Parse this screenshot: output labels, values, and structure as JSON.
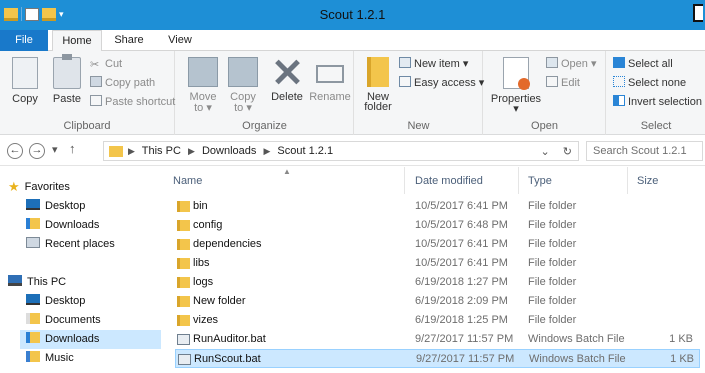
{
  "window": {
    "title": "Scout 1.2.1"
  },
  "tabs": [
    "File",
    "Home",
    "Share",
    "View"
  ],
  "ribbon": {
    "clipboard": {
      "label": "Clipboard",
      "copy": "Copy",
      "paste": "Paste",
      "cut": "Cut",
      "copy_path": "Copy path",
      "paste_shortcut": "Paste shortcut"
    },
    "organize": {
      "label": "Organize",
      "move_to": "Move",
      "move_to_sub": "to ▾",
      "copy_to": "Copy",
      "copy_to_sub": "to ▾",
      "delete": "Delete",
      "rename": "Rename"
    },
    "new": {
      "label": "New",
      "new_folder": "New",
      "new_folder_sub": "folder",
      "new_item": "New item ▾",
      "easy_access": "Easy access ▾"
    },
    "open": {
      "label": "Open",
      "properties": "Properties",
      "properties_sub": "▾",
      "open": "Open ▾",
      "edit": "Edit"
    },
    "select": {
      "label": "Select",
      "select_all": "Select all",
      "select_none": "Select none",
      "invert": "Invert selection"
    }
  },
  "address": {
    "crumbs": [
      "This PC",
      "Downloads",
      "Scout 1.2.1"
    ],
    "dropdown": "⌄",
    "refresh": "↻",
    "search_placeholder": "Search Scout 1.2.1"
  },
  "nav": {
    "favorites": "Favorites",
    "fav_items": [
      "Desktop",
      "Downloads",
      "Recent places"
    ],
    "this_pc": "This PC",
    "pc_items": [
      "Desktop",
      "Documents",
      "Downloads",
      "Music"
    ]
  },
  "columns": {
    "name": "Name",
    "date": "Date modified",
    "type": "Type",
    "size": "Size"
  },
  "files": [
    {
      "name": "bin",
      "date": "10/5/2017 6:41 PM",
      "type": "File folder",
      "size": ""
    },
    {
      "name": "config",
      "date": "10/5/2017 6:48 PM",
      "type": "File folder",
      "size": ""
    },
    {
      "name": "dependencies",
      "date": "10/5/2017 6:41 PM",
      "type": "File folder",
      "size": ""
    },
    {
      "name": "libs",
      "date": "10/5/2017 6:41 PM",
      "type": "File folder",
      "size": ""
    },
    {
      "name": "logs",
      "date": "6/19/2018 1:27 PM",
      "type": "File folder",
      "size": ""
    },
    {
      "name": "New folder",
      "date": "6/19/2018 2:09 PM",
      "type": "File folder",
      "size": ""
    },
    {
      "name": "vizes",
      "date": "6/19/2018 1:25 PM",
      "type": "File folder",
      "size": ""
    },
    {
      "name": "RunAuditor.bat",
      "date": "9/27/2017 11:57 PM",
      "type": "Windows Batch File",
      "size": "1 KB"
    },
    {
      "name": "RunScout.bat",
      "date": "9/27/2017 11:57 PM",
      "type": "Windows Batch File",
      "size": "1 KB"
    }
  ]
}
